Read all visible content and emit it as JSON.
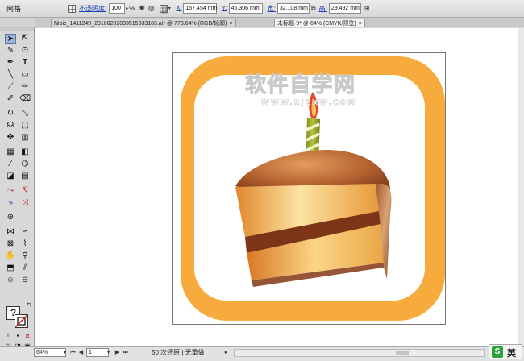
{
  "control_bar": {
    "mode_label": "网格",
    "opacity_label": "不透明度:",
    "opacity_value": "100",
    "percent_sign": "%",
    "x_label": "X:",
    "x_value": "157.454 mm",
    "y_label": "Y:",
    "y_value": "46.306 mm",
    "width_label": "宽:",
    "width_value": "32.108 mm",
    "height_label": "高:",
    "height_value": "29.492 mm"
  },
  "tabs": [
    {
      "label": "Nipic_1411249_20100202003515033183.ai* @ 773.64% (RGB/轮廓)",
      "close": "×",
      "active": false
    },
    {
      "label": "未标题-9* @ 64% (CMYK/预览)",
      "close": "×",
      "active": true
    }
  ],
  "watermark": {
    "title": "软件自学网",
    "url": "WWW.RJZXW.COM"
  },
  "status_bar": {
    "zoom": "64%",
    "page": "1",
    "message": "50 次还原 | 无重做"
  },
  "ime": {
    "logo": "S",
    "lang": "英"
  },
  "colors": {
    "frame_orange": "#f6ab3c",
    "cake_top": "#a9582b",
    "cake_cream": "#f7c86a",
    "candle_green": "#a3ad2e",
    "link_blue": "#1a3fb0"
  }
}
